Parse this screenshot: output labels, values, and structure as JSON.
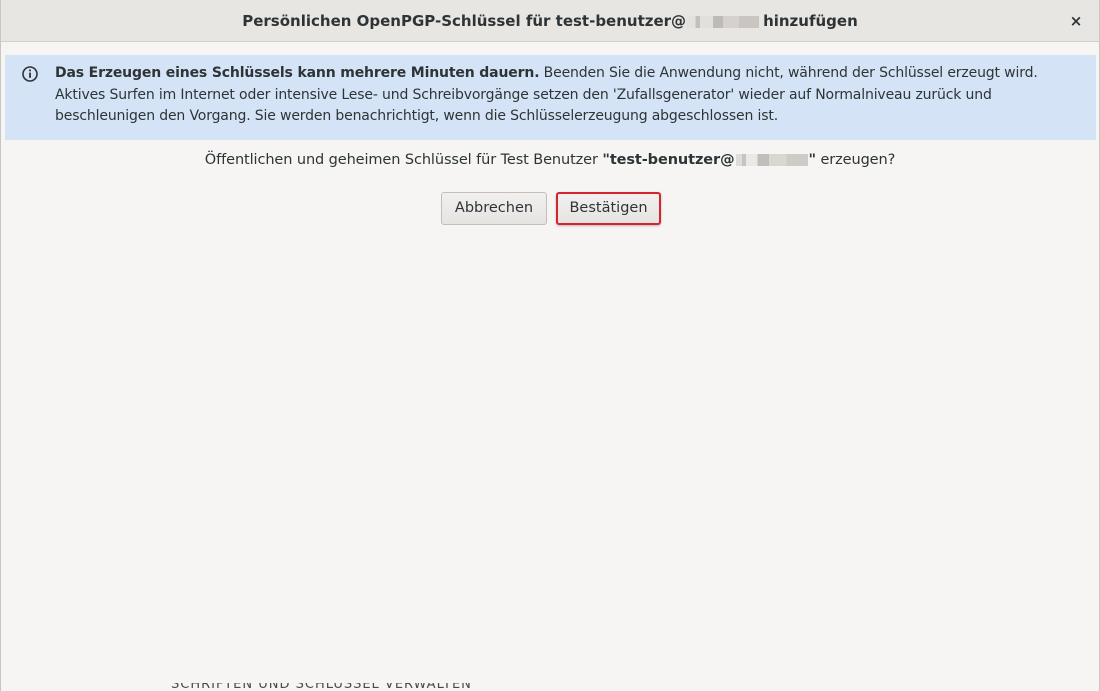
{
  "window": {
    "title_before": "Persönlichen OpenPGP-Schlüssel für test-benutzer@",
    "title_after": "hinzufügen",
    "close_glyph": "×"
  },
  "infobar": {
    "icon": "info-circle-icon",
    "bold_text": "Das Erzeugen eines Schlüssels kann mehrere Minuten dauern.",
    "body_text": "Beenden Sie die Anwendung nicht, während der Schlüssel erzeugt wird. Aktives Surfen im Internet oder intensive Lese- und Schreibvorgänge setzen den 'Zufallsgenerator' wieder auf Normalniveau zurück und beschleunigen den Vorgang. Sie werden benachrichtigt, wenn die Schlüsselerzeugung abgeschlossen ist.",
    "background": "#d4e4f6"
  },
  "question": {
    "prefix": "Öffentlichen und geheimen Schlüssel für Test Benutzer ",
    "email_before": "\"test-benutzer@",
    "email_after": "\"",
    "suffix": " erzeugen?"
  },
  "buttons": {
    "cancel_label": "Abbrechen",
    "confirm_label": "Bestätigen",
    "highlight_color": "#d6232c"
  },
  "background_window": {
    "partial_text": "SCHRIFTEN UND SCHLÜSSEL VERWALTEN"
  }
}
